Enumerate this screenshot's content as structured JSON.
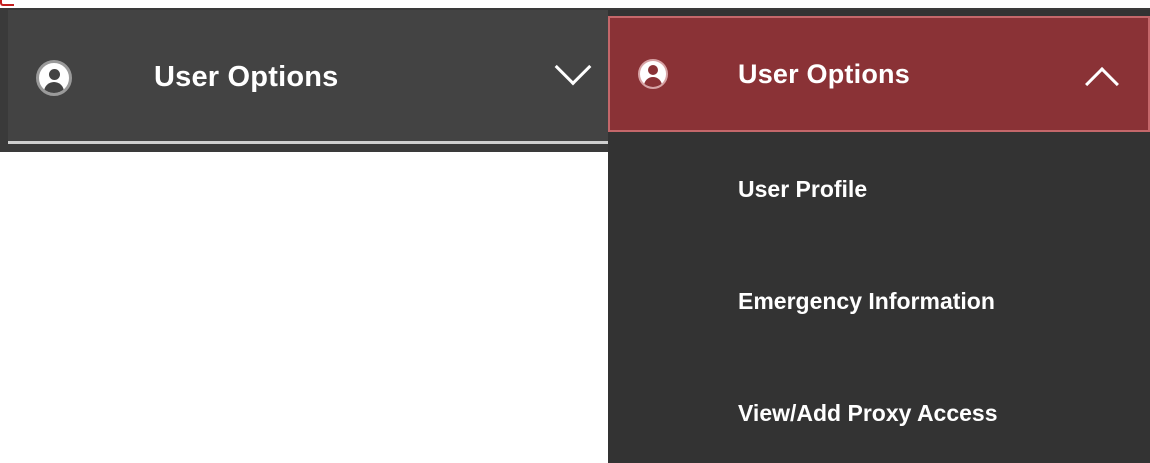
{
  "collapsed_menu": {
    "title": "User Options",
    "icon": "user-icon",
    "toggle_icon": "chevron-down-icon"
  },
  "expanded_menu": {
    "title": "User Options",
    "icon": "user-icon",
    "toggle_icon": "chevron-up-icon",
    "items": [
      {
        "label": "User Profile"
      },
      {
        "label": "Emergency Information"
      },
      {
        "label": "View/Add Proxy Access"
      }
    ]
  },
  "colors": {
    "collapsed_bg": "#434343",
    "expanded_header_bg": "#8a3236",
    "expanded_body_bg": "#333333",
    "annotation": "#c41e1e"
  }
}
